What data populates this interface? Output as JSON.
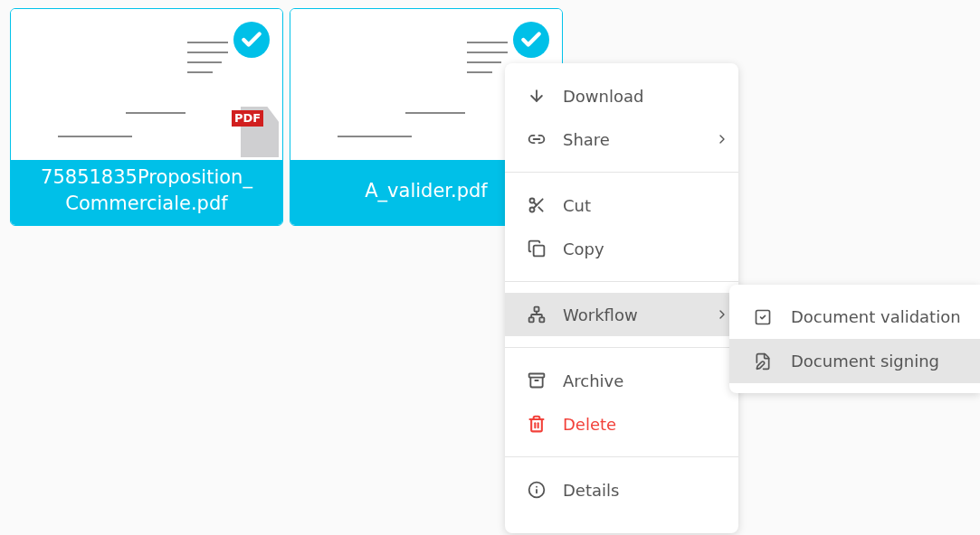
{
  "files": [
    {
      "name": "75851835Proposition_\nCommerciale.pdf",
      "selected": true,
      "pdf_badge": "PDF"
    },
    {
      "name": "A_valider.pdf",
      "selected": true
    }
  ],
  "context_menu": {
    "groups": [
      [
        {
          "label": "Download",
          "kind": "normal",
          "has_submenu": false,
          "highlighted": false
        },
        {
          "label": "Share",
          "kind": "normal",
          "has_submenu": true,
          "highlighted": false
        }
      ],
      [
        {
          "label": "Cut",
          "kind": "normal",
          "has_submenu": false,
          "highlighted": false
        },
        {
          "label": "Copy",
          "kind": "normal",
          "has_submenu": false,
          "highlighted": false
        }
      ],
      [
        {
          "label": "Workflow",
          "kind": "normal",
          "has_submenu": true,
          "highlighted": true
        }
      ],
      [
        {
          "label": "Archive",
          "kind": "normal",
          "has_submenu": false,
          "highlighted": false
        },
        {
          "label": "Delete",
          "kind": "danger",
          "has_submenu": false,
          "highlighted": false
        }
      ],
      [
        {
          "label": "Details",
          "kind": "normal",
          "has_submenu": false,
          "highlighted": false
        }
      ]
    ]
  },
  "submenu": {
    "items": [
      {
        "label": "Document validation",
        "highlighted": false
      },
      {
        "label": "Document signing",
        "highlighted": true
      }
    ]
  }
}
